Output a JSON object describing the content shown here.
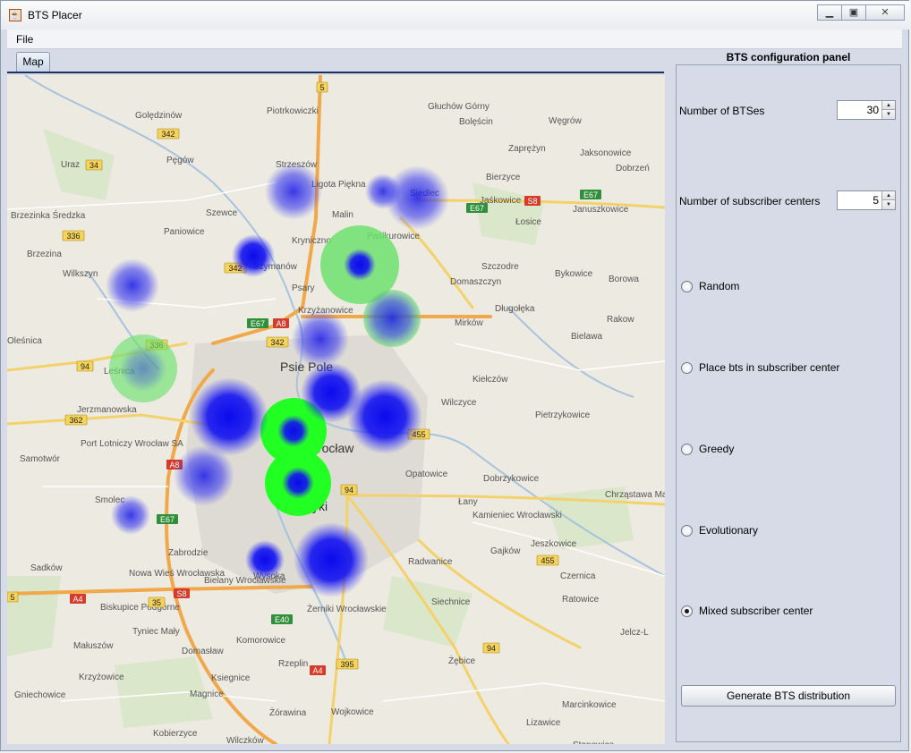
{
  "window": {
    "title": "BTS Placer",
    "controls": {
      "minimize": "▁",
      "restore": "▣",
      "close": "✕"
    }
  },
  "menu": {
    "file": "File"
  },
  "tabs": {
    "map": "Map"
  },
  "panel": {
    "title": "BTS configuration panel",
    "num_bts_label": "Number of BTSes",
    "num_bts_value": "30",
    "num_centers_label": "Number of subscriber centers",
    "num_centers_value": "5",
    "options": [
      "Random",
      "Place bts in subscriber center",
      "Greedy",
      "Evolutionary",
      "Mixed subscriber center"
    ],
    "selected_option": "Mixed subscriber center",
    "generate_label": "Generate BTS distribution"
  },
  "map": {
    "place_labels": [
      "Golędzinów",
      "Piotrkowiczki",
      "Głuchów Górny",
      "Bolęścin",
      "Węgrów",
      "Pęgów",
      "Zaprężyn",
      "Jaksonowice",
      "Uraz",
      "Dobrzeń",
      "Strzeszów",
      "Ligota Piękna",
      "Siedlec",
      "Brzezinka Średzka",
      "Szewce",
      "Malin",
      "Bierzyce",
      "Jaśkowice",
      "Łosice",
      "Januszkowice",
      "Brzezina",
      "Paniowice",
      "Kryniczno",
      "Pasikurowice",
      "Szczodre",
      "Bykowice",
      "Wilkszyn",
      "Szymanów",
      "Psary",
      "Domaszczyn",
      "Borowa",
      "Krzyżanowice",
      "Mirków",
      "Długołęka",
      "Rakow",
      "Psie Pole",
      "Bielawa",
      "Leśnica",
      "Kiełczów",
      "Jerzmanowska",
      "Wilczyce",
      "Pietrzykowice",
      "Port Lotniczy Wrocław SA",
      "Samotwór",
      "Opatowice",
      "Dobrzykowice",
      "Chrząstawa Mała",
      "Smolec",
      "Łany",
      "Kamieniec Wrocławski",
      "Zabrodzie",
      "Gajków",
      "Jeszkowice",
      "Sadków",
      "Nowa Wieś Wrocławska",
      "Radwanice",
      "Czernica",
      "Bielany Wrocławskie",
      "Wysoka",
      "Siechnice",
      "Ratowice",
      "Biskupice Podgórne",
      "Żerniki Wrocławskie",
      "Tyniec Mały",
      "Domasław",
      "Jelcz-L",
      "Małuszów",
      "Komorowice",
      "Krzyżowice",
      "Rzeplin",
      "Żębice",
      "Gniechowice",
      "Ksiegnice",
      "Magnice",
      "Marcinkowice",
      "Żórawina",
      "Wojkowice",
      "Lizawice",
      "Kobierzyce",
      "Wilczków",
      "Stanowice",
      "Oleśnica",
      "Wrocław",
      "Krzyki"
    ],
    "road_badges": [
      "5",
      "342",
      "34",
      "S8",
      "E67",
      "E67",
      "336",
      "342",
      "A8",
      "E67",
      "342",
      "336",
      "94",
      "362",
      "A8",
      "455",
      "94",
      "E67",
      "455",
      "A4",
      "35",
      "S8",
      "E40",
      "94",
      "A4",
      "395",
      "5"
    ],
    "bts_count": 30,
    "subscriber_centers": 5
  },
  "colors": {
    "bts": "#1414f0",
    "coverage": "#22ff22",
    "panel_bg": "#d6dbe7"
  }
}
